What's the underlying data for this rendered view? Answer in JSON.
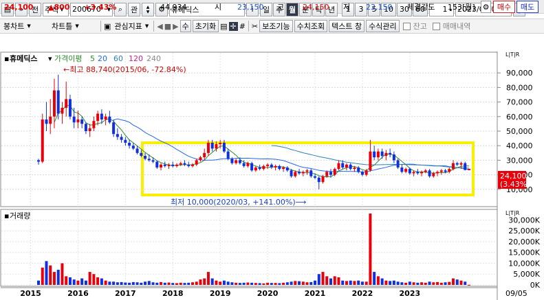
{
  "toolbar1": {
    "btn_double_up": "»",
    "btn_prev": "전",
    "market_type": "주식",
    "stock_code": "200670",
    "search_icon": "⌕",
    "btn_gwan": "관",
    "stock_name": "휴메딕스",
    "btn_i": "i",
    "periods": [
      "일",
      "주",
      "월",
      "분",
      "틱",
      "년"
    ],
    "selected_period": "월",
    "counts": [
      "1",
      "3",
      "5",
      "10",
      "30",
      "60"
    ],
    "count_value": "1",
    "date": "2023/04/04",
    "btn_dang": "당"
  },
  "toolbar2": {
    "bong_chart": "봉차트",
    "chart_tool": "차트틀",
    "indicator": "관심지표",
    "reset": "초기화",
    "aux_func": "보조기능",
    "num_query": "수치조회",
    "text_window": "텍스트 창",
    "formula_mgmt": "수식관리",
    "balance": "잔고",
    "trade_history": "매매내역",
    "su": "수"
  },
  "quote": {
    "price": "24,100",
    "change": "▲800",
    "change_pct": "+3.43%",
    "volume": "44,934",
    "open_label": "시",
    "open": "23,150",
    "high_label": "고",
    "high": "24,150",
    "low_label": "저",
    "low": "23,150",
    "strength_label": "체결강도",
    "strength": "153[월]",
    "buy": "매수",
    "sell": "매도"
  },
  "legend": {
    "stock": "휴메딕스",
    "ma_label": "가격이평",
    "ma": [
      "5",
      "20",
      "60",
      "120",
      "240"
    ]
  },
  "annot": {
    "high": "←최고 88,740(2015/06, -72.84%)",
    "low": "최저 10,000(2020/03, +141.00%)⟶"
  },
  "price_axis": [
    "90,000",
    "80,000",
    "70,000",
    "60,000",
    "50,000",
    "40,000",
    "30,000",
    "20,000",
    "10,000"
  ],
  "vol_axis": [
    "30,000K",
    "25,000K",
    "20,000K",
    "15,000K",
    "10,000K",
    "5,000K",
    "0K"
  ],
  "years": [
    "2015",
    "2016",
    "2017",
    "2018",
    "2019",
    "2020",
    "2021",
    "2022",
    "2023"
  ],
  "current_price_tag": "24,100",
  "current_pct_tag": "(3.43%)",
  "volume_label": "거래량",
  "bottom_date": "09/05",
  "side_tag": "L|T|R",
  "colors": {
    "up": "#e8000b",
    "down": "#1030e0",
    "ma5": "#2e8b2e",
    "ma20": "#2266ee",
    "ma60": "#2a80b9",
    "ma120": "#c81e8a",
    "ma240": "#aaaaaa",
    "highlight": "#f8f000"
  },
  "chart_data": {
    "type": "candlestick",
    "price_range": [
      0,
      100000
    ],
    "volume_range_k": [
      0,
      33000
    ],
    "candles_ohlc": [
      [
        30000,
        31000,
        27000,
        29000
      ],
      [
        29000,
        62000,
        28000,
        58000
      ],
      [
        58000,
        70000,
        50000,
        55000
      ],
      [
        55000,
        72000,
        48000,
        60000
      ],
      [
        60000,
        86000,
        52000,
        78000
      ],
      [
        78000,
        88740,
        58000,
        62000
      ],
      [
        62000,
        70000,
        55000,
        66000
      ],
      [
        66000,
        84000,
        60000,
        72000
      ],
      [
        72000,
        75000,
        58000,
        60000
      ],
      [
        60000,
        66000,
        52000,
        56000
      ],
      [
        56000,
        64000,
        52000,
        58000
      ],
      [
        58000,
        60000,
        52000,
        55000
      ],
      [
        55000,
        56000,
        48000,
        50000
      ],
      [
        50000,
        55000,
        46000,
        52000
      ],
      [
        52000,
        60000,
        50000,
        57000
      ],
      [
        57000,
        64000,
        54000,
        62000
      ],
      [
        62000,
        65000,
        55000,
        58000
      ],
      [
        58000,
        62000,
        54000,
        60000
      ],
      [
        60000,
        64000,
        55000,
        56000
      ],
      [
        56000,
        58000,
        46000,
        48000
      ],
      [
        48000,
        52000,
        44000,
        46000
      ],
      [
        46000,
        48000,
        42000,
        44000
      ],
      [
        44000,
        46000,
        40000,
        42000
      ],
      [
        42000,
        44000,
        38000,
        40000
      ],
      [
        40000,
        42000,
        37000,
        38000
      ],
      [
        38000,
        40000,
        34000,
        35000
      ],
      [
        35000,
        37000,
        32000,
        33000
      ],
      [
        33000,
        35000,
        30000,
        31000
      ],
      [
        31000,
        34000,
        29000,
        30000
      ],
      [
        30000,
        32000,
        28000,
        29000
      ],
      [
        29000,
        30000,
        24000,
        25000
      ],
      [
        25000,
        28000,
        23000,
        27000
      ],
      [
        27000,
        29000,
        25000,
        26000
      ],
      [
        26000,
        28000,
        24000,
        27000
      ],
      [
        27000,
        29000,
        25000,
        26000
      ],
      [
        26000,
        28000,
        25000,
        27000
      ],
      [
        27000,
        29000,
        26000,
        28000
      ],
      [
        28000,
        30000,
        26000,
        27000
      ],
      [
        27000,
        29000,
        25000,
        26000
      ],
      [
        26000,
        28000,
        25000,
        27000
      ],
      [
        27000,
        31000,
        26000,
        30000
      ],
      [
        30000,
        33000,
        29000,
        32000
      ],
      [
        32000,
        38000,
        30000,
        35000
      ],
      [
        35000,
        44000,
        33000,
        42000
      ],
      [
        42000,
        44000,
        36000,
        38000
      ],
      [
        38000,
        43000,
        36000,
        41000
      ],
      [
        41000,
        44000,
        38000,
        42000
      ],
      [
        42000,
        44000,
        35000,
        36000
      ],
      [
        36000,
        38000,
        30000,
        31000
      ],
      [
        31000,
        32000,
        27000,
        28000
      ],
      [
        28000,
        31000,
        27000,
        30000
      ],
      [
        30000,
        32000,
        27000,
        28000
      ],
      [
        28000,
        30000,
        25000,
        26000
      ],
      [
        26000,
        29000,
        25000,
        28000
      ],
      [
        28000,
        29000,
        22000,
        23000
      ],
      [
        23000,
        26000,
        22000,
        25000
      ],
      [
        25000,
        27000,
        23000,
        24000
      ],
      [
        24000,
        27000,
        23000,
        26000
      ],
      [
        26000,
        28000,
        24000,
        27000
      ],
      [
        27000,
        28000,
        24000,
        25000
      ],
      [
        25000,
        27000,
        23000,
        26000
      ],
      [
        26000,
        27000,
        23000,
        24000
      ],
      [
        24000,
        26000,
        22000,
        25000
      ],
      [
        25000,
        26000,
        22000,
        23000
      ],
      [
        23000,
        24000,
        18000,
        19000
      ],
      [
        19000,
        23000,
        18000,
        22000
      ],
      [
        22000,
        24000,
        20000,
        21000
      ],
      [
        21000,
        23000,
        19000,
        22000
      ],
      [
        22000,
        24000,
        20000,
        23000
      ],
      [
        23000,
        24000,
        18000,
        19000
      ],
      [
        19000,
        21000,
        17000,
        18000
      ],
      [
        18000,
        19000,
        10000,
        15000
      ],
      [
        15000,
        20000,
        14000,
        19000
      ],
      [
        19000,
        23000,
        18000,
        22000
      ],
      [
        22000,
        24000,
        18000,
        20000
      ],
      [
        20000,
        25000,
        19000,
        24000
      ],
      [
        24000,
        30000,
        23000,
        28000
      ],
      [
        28000,
        30000,
        24000,
        25000
      ],
      [
        25000,
        28000,
        23000,
        27000
      ],
      [
        27000,
        28000,
        23000,
        24000
      ],
      [
        24000,
        26000,
        22000,
        25000
      ],
      [
        25000,
        26000,
        21000,
        22000
      ],
      [
        22000,
        23000,
        19000,
        20000
      ],
      [
        20000,
        24000,
        19000,
        23000
      ],
      [
        23000,
        44000,
        22000,
        36000
      ],
      [
        36000,
        40000,
        30000,
        32000
      ],
      [
        32000,
        38000,
        30000,
        36000
      ],
      [
        36000,
        38000,
        31000,
        33000
      ],
      [
        33000,
        37000,
        30000,
        35000
      ],
      [
        35000,
        38000,
        32000,
        34000
      ],
      [
        34000,
        36000,
        28000,
        30000
      ],
      [
        30000,
        31000,
        24000,
        25000
      ],
      [
        25000,
        27000,
        21000,
        22000
      ],
      [
        22000,
        25000,
        21000,
        24000
      ],
      [
        24000,
        25000,
        20000,
        21000
      ],
      [
        21000,
        23000,
        19000,
        22000
      ],
      [
        22000,
        24000,
        20000,
        21000
      ],
      [
        21000,
        23000,
        19000,
        22000
      ],
      [
        22000,
        24000,
        21000,
        23000
      ],
      [
        23000,
        24000,
        18000,
        19000
      ],
      [
        19000,
        22000,
        18000,
        21000
      ],
      [
        21000,
        23000,
        19000,
        22000
      ],
      [
        22000,
        24000,
        20000,
        23000
      ],
      [
        23000,
        24000,
        21000,
        22000
      ],
      [
        22000,
        25000,
        21000,
        24000
      ],
      [
        24000,
        30000,
        23000,
        28000
      ],
      [
        28000,
        29000,
        26000,
        27000
      ],
      [
        27000,
        29000,
        24000,
        28000
      ],
      [
        28000,
        29000,
        23000,
        23300
      ],
      [
        23150,
        24150,
        23150,
        24100
      ]
    ],
    "volume_k": [
      2000,
      8000,
      11000,
      9000,
      6000,
      7000,
      10000,
      4000,
      3500,
      2500,
      2000,
      3000,
      2000,
      6000,
      5000,
      3500,
      3000,
      2000,
      1500,
      1500,
      1200,
      1300,
      1100,
      1000,
      1300,
      1200,
      1000,
      1500,
      1800,
      1200,
      1000,
      1300,
      1000,
      1100,
      900,
      800,
      1000,
      900,
      1000,
      1200,
      1500,
      2500,
      3000,
      6000,
      3000,
      2000,
      1500,
      2000,
      1500,
      1200,
      1000,
      900,
      1000,
      1100,
      1000,
      900,
      800,
      700,
      1000,
      900,
      900,
      800,
      1000,
      1200,
      1500,
      1800,
      1700,
      1500,
      1200,
      1300,
      2000,
      5000,
      6000,
      4000,
      3000,
      4000,
      3500,
      2000,
      1800,
      2000,
      1800,
      2000,
      1500,
      1500,
      33000,
      6000,
      4000,
      3000,
      2000,
      1800,
      2000,
      1500,
      1200,
      1000,
      1500,
      1200,
      1000,
      1200,
      1000,
      1500,
      1200,
      1300,
      1000,
      1200,
      1400,
      3000,
      2500,
      2000,
      1500,
      45
    ]
  }
}
